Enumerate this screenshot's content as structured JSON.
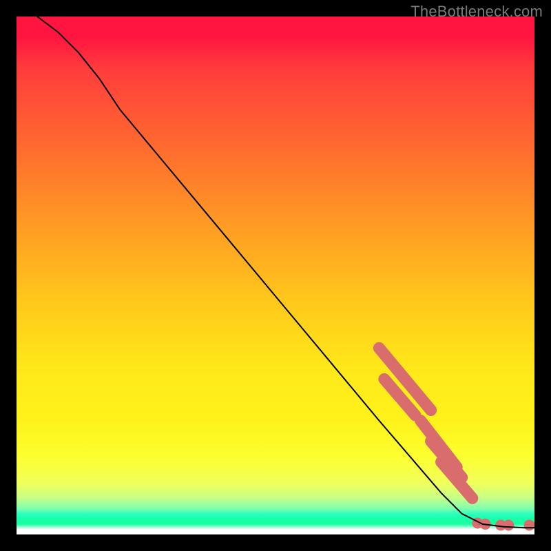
{
  "watermark": "TheBottleneck.com",
  "chart_data": {
    "type": "line",
    "title": "",
    "xlabel": "",
    "ylabel": "",
    "xlim": [
      0,
      100
    ],
    "ylim": [
      0,
      100
    ],
    "grid": false,
    "legend": false,
    "curve": [
      {
        "x": 4,
        "y": 100
      },
      {
        "x": 8,
        "y": 97
      },
      {
        "x": 12,
        "y": 93
      },
      {
        "x": 16,
        "y": 88
      },
      {
        "x": 20,
        "y": 82
      },
      {
        "x": 30,
        "y": 70
      },
      {
        "x": 40,
        "y": 58
      },
      {
        "x": 50,
        "y": 46
      },
      {
        "x": 60,
        "y": 34
      },
      {
        "x": 70,
        "y": 22
      },
      {
        "x": 76,
        "y": 15
      },
      {
        "x": 82,
        "y": 8
      },
      {
        "x": 86,
        "y": 4
      },
      {
        "x": 90,
        "y": 2
      },
      {
        "x": 94,
        "y": 1.5
      },
      {
        "x": 98,
        "y": 1.3
      },
      {
        "x": 100,
        "y": 1.3
      }
    ],
    "highlighted_segments": [
      {
        "x0": 70,
        "y0": 36,
        "x1": 80,
        "y1": 24
      },
      {
        "x0": 71,
        "y0": 30,
        "x1": 77,
        "y1": 23
      },
      {
        "x0": 78,
        "y0": 22,
        "x1": 85,
        "y1": 13
      },
      {
        "x0": 80,
        "y0": 18,
        "x1": 86,
        "y1": 11
      },
      {
        "x0": 82,
        "y0": 14,
        "x1": 88,
        "y1": 7
      }
    ],
    "flat_markers": [
      {
        "x": 89,
        "y": 2.2
      },
      {
        "x": 90.5,
        "y": 2.0
      },
      {
        "x": 93.5,
        "y": 1.8
      },
      {
        "x": 95,
        "y": 1.8
      },
      {
        "x": 99,
        "y": 1.8
      }
    ],
    "colors": {
      "curve": "#000000",
      "marker": "#d96d6d"
    }
  }
}
